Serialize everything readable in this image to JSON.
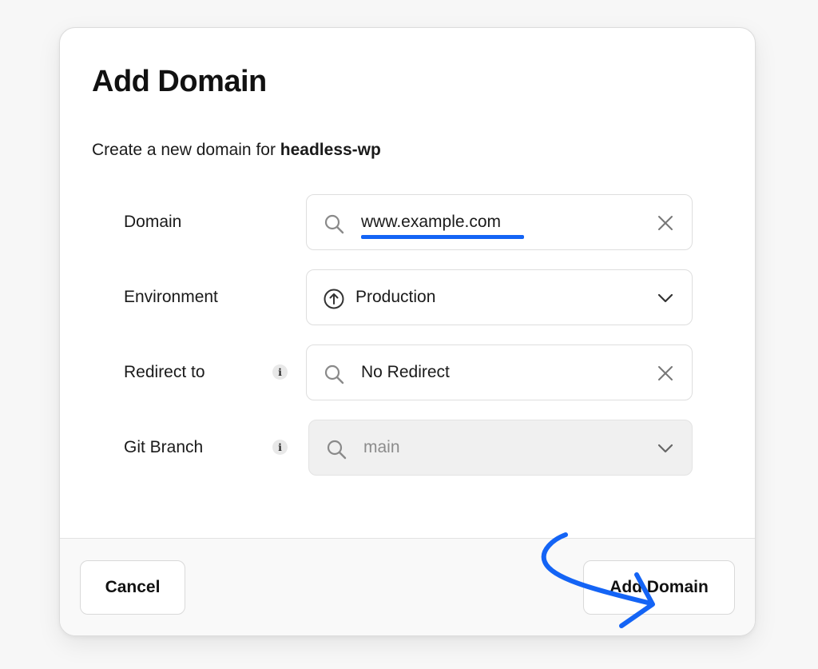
{
  "modal": {
    "title": "Add Domain",
    "subtitle_prefix": "Create a new domain for ",
    "subtitle_project": "headless-wp"
  },
  "fields": {
    "domain": {
      "label": "Domain",
      "value": "www.example.com",
      "lead_icon": "search-icon",
      "trail_icon": "close-icon"
    },
    "environment": {
      "label": "Environment",
      "value": "Production",
      "lead_icon": "arrow-up-circle-icon",
      "trail_icon": "chevron-down-icon"
    },
    "redirect": {
      "label": "Redirect to",
      "value": "No Redirect",
      "lead_icon": "search-icon",
      "trail_icon": "close-icon",
      "info_icon": "info-icon"
    },
    "git_branch": {
      "label": "Git Branch",
      "placeholder": "main",
      "disabled": true,
      "lead_icon": "search-icon",
      "trail_icon": "chevron-down-icon",
      "info_icon": "info-icon"
    }
  },
  "footer": {
    "cancel_label": "Cancel",
    "add_label": "Add Domain"
  },
  "colors": {
    "accent": "#1464f5",
    "disabled_field_bg": "#f0f0f0",
    "footer_bg": "#f9f9f9"
  }
}
